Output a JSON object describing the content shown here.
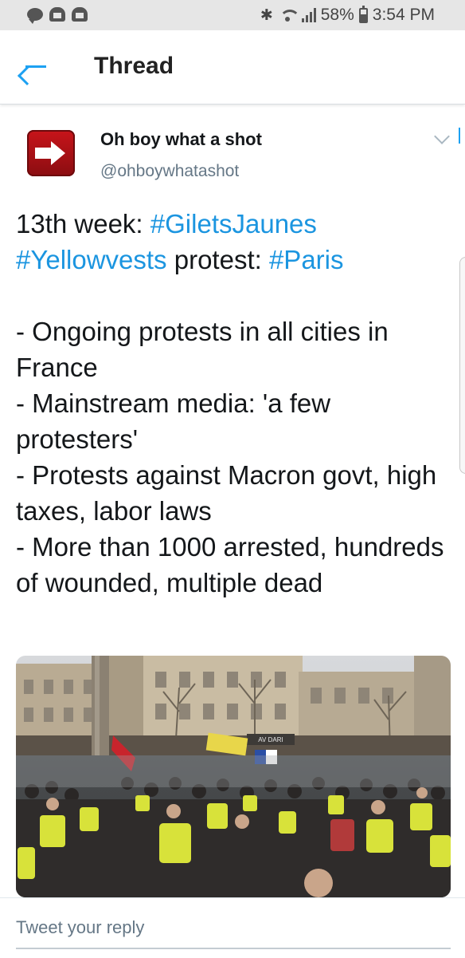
{
  "status_bar": {
    "notification_icons": [
      "chat-bubble-icon",
      "mail-icon",
      "mail-icon"
    ],
    "battery": "58%",
    "time": "3:54 PM"
  },
  "header": {
    "back_icon": "arrow-left-icon",
    "title": "Thread",
    "accent_color": "#1da1f2"
  },
  "tweet": {
    "author_name": "Oh boy what a shot",
    "author_handle": "@ohboywhatashot",
    "text": {
      "line1_prefix": "13th week: ",
      "tag1": "#GiletsJaunes",
      "tag2": "#Yellowvests",
      "line2_mid": " protest: ",
      "tag3": "#Paris",
      "bullets": [
        "- Ongoing protests in all cities in France",
        "- Mainstream media: 'a few protesters'",
        "- Protests against Macron govt, high taxes, labor laws",
        "- More than 1000 arrested, hundreds of wounded, multiple dead"
      ]
    },
    "hashtag_color": "#1b95e0",
    "media_banner_text": "",
    "media_sign_text": "AV DARI"
  },
  "reply": {
    "placeholder": "Tweet your reply"
  }
}
